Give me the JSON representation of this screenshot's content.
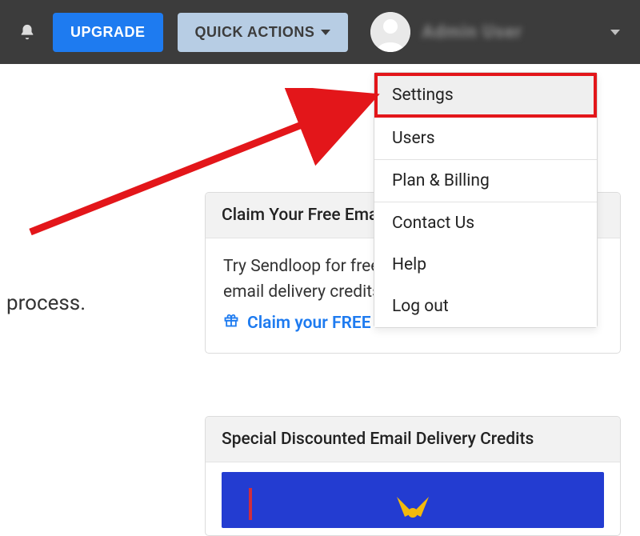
{
  "topbar": {
    "upgrade_label": "UPGRADE",
    "quick_actions_label": "QUICK ACTIONS",
    "username": "Admin User"
  },
  "dropdown": {
    "items": [
      {
        "label": "Settings",
        "highlighted": true
      },
      {
        "label": "Users"
      },
      {
        "label": "Plan & Billing",
        "separator_before": true
      },
      {
        "label": "Contact Us",
        "separator_before": true
      },
      {
        "label": "Help"
      },
      {
        "label": "Log out"
      }
    ]
  },
  "side_text": "process.",
  "card_free": {
    "header": "Claim Your Free Email Credits",
    "body": "Try Sendloop for free with the complimentary email delivery credits given to your account.",
    "link": "Claim your FREE credits"
  },
  "card_discount": {
    "header": "Special Discounted Email Delivery Credits"
  }
}
